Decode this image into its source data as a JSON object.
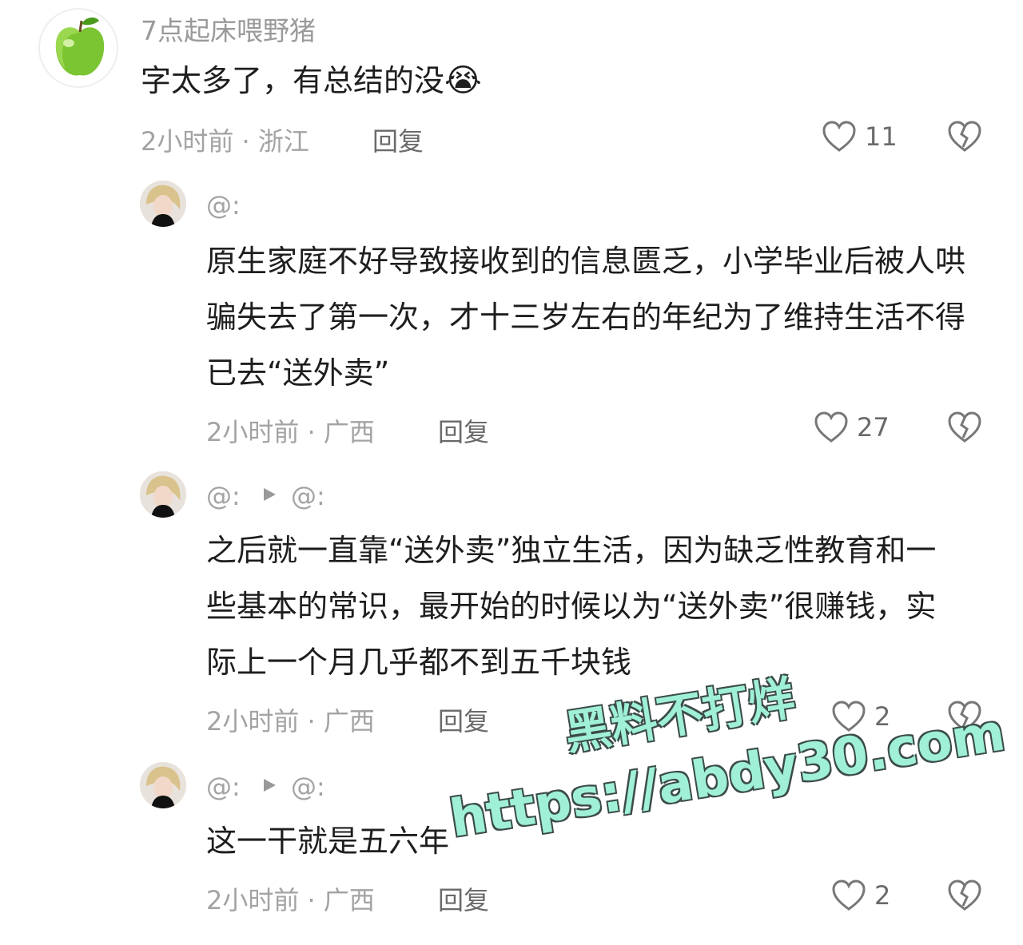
{
  "main_comment": {
    "username": "7点起床喂野猪",
    "text": "字太多了，有总结的没",
    "emoji": "😭",
    "time_location": "2小时前 · 浙江",
    "reply_label": "回复",
    "likes": "11"
  },
  "replies": [
    {
      "at_from": "@:",
      "at_to": "",
      "text": "原生家庭不好导致接收到的信息匮乏，小学毕业后被人哄骗失去了第一次，才十三岁左右的年纪为了维持生活不得已去“送外卖”",
      "time_location": "2小时前 · 广西",
      "reply_label": "回复",
      "likes": "27"
    },
    {
      "at_from": "@:",
      "at_to": "@:",
      "text": "之后就一直靠“送外卖”独立生活，因为缺乏性教育和一些基本的常识，最开始的时候以为“送外卖”很赚钱，实际上一个月几乎都不到五千块钱",
      "time_location": "2小时前 · 广西",
      "reply_label": "回复",
      "likes": "2"
    },
    {
      "at_from": "@:",
      "at_to": "@:",
      "text": "这一干就是五六年",
      "time_location": "2小时前 · 广西",
      "reply_label": "回复",
      "likes": "2"
    }
  ],
  "watermark": {
    "line1": "黑料不打烊",
    "line2": "https://abdy30.com"
  },
  "colors": {
    "text": "#1e1e1e",
    "meta": "#a3a3a3",
    "watermark_fill": "#9ff0d6",
    "watermark_stroke": "#3c4b4a"
  }
}
